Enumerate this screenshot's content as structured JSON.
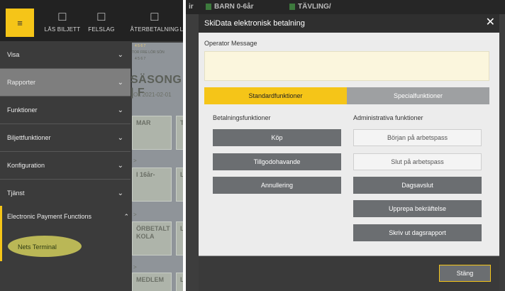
{
  "left": {
    "topbar": {
      "menu_icon": "hamburger-icon",
      "buttons": [
        {
          "label": "LÄS BILJETT",
          "icon": "ticket-scan-icon"
        },
        {
          "label": "FELSLAG",
          "icon": "ticket-error-icon"
        },
        {
          "label": "ÅTERBETALNING",
          "icon": "refund-icon"
        }
      ],
      "trailing_letter": "L"
    },
    "background": {
      "season_title": "SÄSONG | F",
      "date": "OL   2021-02-01",
      "days_row_1": "4   5   6   7",
      "days_row_2": "TOR  FRE  LÖR  SÖN",
      "days_row_3": "4   5   6   7",
      "cards": [
        {
          "line1": "MAR",
          "line2": ""
        },
        {
          "line1": "I 16år-",
          "line2": ""
        },
        {
          "line1": "ÖRBETALT",
          "line2": "KOLA"
        },
        {
          "line1": "MEDLEM",
          "line2": ""
        }
      ],
      "side_letters": [
        "T",
        "L",
        "L",
        "L"
      ]
    },
    "drawer": {
      "items": [
        {
          "label": "Visa",
          "chevron": "⌄"
        },
        {
          "label": "Rapporter",
          "chevron": "⌄"
        },
        {
          "label": "Funktioner",
          "chevron": "⌄"
        },
        {
          "label": "Biljettfunktioner",
          "chevron": "⌄"
        },
        {
          "label": "Konfiguration",
          "chevron": "⌄"
        },
        {
          "label": "Tjänst",
          "chevron": "⌄"
        }
      ],
      "expanded": {
        "label": "Electronic Payment Functions",
        "chevron": "⌃"
      },
      "sub_item": "Nets Terminal"
    }
  },
  "right": {
    "background_bar": {
      "left_text": "ir",
      "label_1": "BARN 0-6år",
      "label_2": "TÄVLING/"
    },
    "dialog": {
      "title": "SkiData elektronisk betalning",
      "close_glyph": "✕",
      "operator_label": "Operator Message",
      "operator_message": "",
      "tabs": [
        "Standardfunktioner",
        "Specialfunktioner"
      ],
      "payment_heading": "Betalningsfunktioner",
      "admin_heading": "Administrativa funktioner",
      "payment_buttons": [
        "Köp",
        "Tillgodohavande",
        "Annullering"
      ],
      "admin_buttons": [
        "Början på arbetspass",
        "Slut på arbetspass",
        "Dagsavslut",
        "Upprepa bekräftelse",
        "Skriv ut dagsrapport"
      ],
      "close_button": "Stäng"
    }
  },
  "colors": {
    "accent": "#f5c518",
    "drawer_bg": "#3b3b3b",
    "drawer_active": "#7e7e7e",
    "button_dark": "#6b6e71",
    "tab_inactive": "#9ea0a2",
    "operator_box": "#fbf6dd",
    "highlight": "#c9c55a"
  }
}
